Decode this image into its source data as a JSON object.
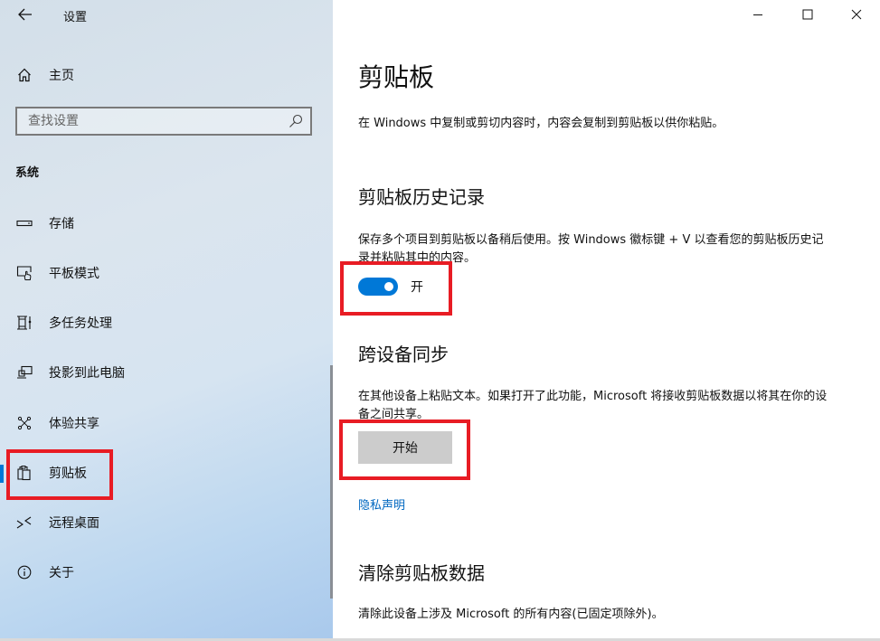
{
  "window": {
    "app_title": "设置",
    "controls": {
      "minimize_icon": "minimize-icon",
      "maximize_icon": "maximize-icon",
      "close_icon": "close-icon"
    }
  },
  "sidebar": {
    "back_icon": "arrow-left-icon",
    "home": {
      "icon": "home-icon",
      "label": "主页"
    },
    "search": {
      "placeholder": "查找设置",
      "value": "",
      "icon": "search-icon"
    },
    "section_label": "系统",
    "items": [
      {
        "icon": "storage-icon",
        "label": "存储",
        "selected": false
      },
      {
        "icon": "tablet-mode-icon",
        "label": "平板模式",
        "selected": false
      },
      {
        "icon": "multitasking-icon",
        "label": "多任务处理",
        "selected": false
      },
      {
        "icon": "project-to-pc-icon",
        "label": "投影到此电脑",
        "selected": false
      },
      {
        "icon": "shared-experiences-icon",
        "label": "体验共享",
        "selected": false
      },
      {
        "icon": "clipboard-icon",
        "label": "剪贴板",
        "selected": true
      },
      {
        "icon": "remote-desktop-icon",
        "label": "远程桌面",
        "selected": false
      },
      {
        "icon": "info-icon",
        "label": "关于",
        "selected": false
      }
    ],
    "accent_color": "#0078d7"
  },
  "main": {
    "title": "剪贴板",
    "intro": "在 Windows 中复制或剪切内容时，内容会复制到剪贴板以供你粘贴。",
    "history": {
      "heading": "剪贴板历史记录",
      "description": "保存多个项目到剪贴板以备稍后使用。按 Windows 徽标键 + V 以查看您的剪贴板历史记录并粘贴其中的内容。",
      "toggle_on": true,
      "toggle_label": "开"
    },
    "sync": {
      "heading": "跨设备同步",
      "description": "在其他设备上粘贴文本。如果打开了此功能，Microsoft 将接收剪贴板数据以将其在你的设备之间共享。",
      "button_label": "开始",
      "privacy_link": "隐私声明"
    },
    "clear": {
      "heading": "清除剪贴板数据",
      "description": "清除此设备上涉及 Microsoft 的所有内容(已固定项除外)。"
    }
  },
  "colors": {
    "accent": "#0078d7",
    "link": "#0067c0",
    "annotation_red": "#e81c24",
    "button_gray": "#cccccc"
  }
}
